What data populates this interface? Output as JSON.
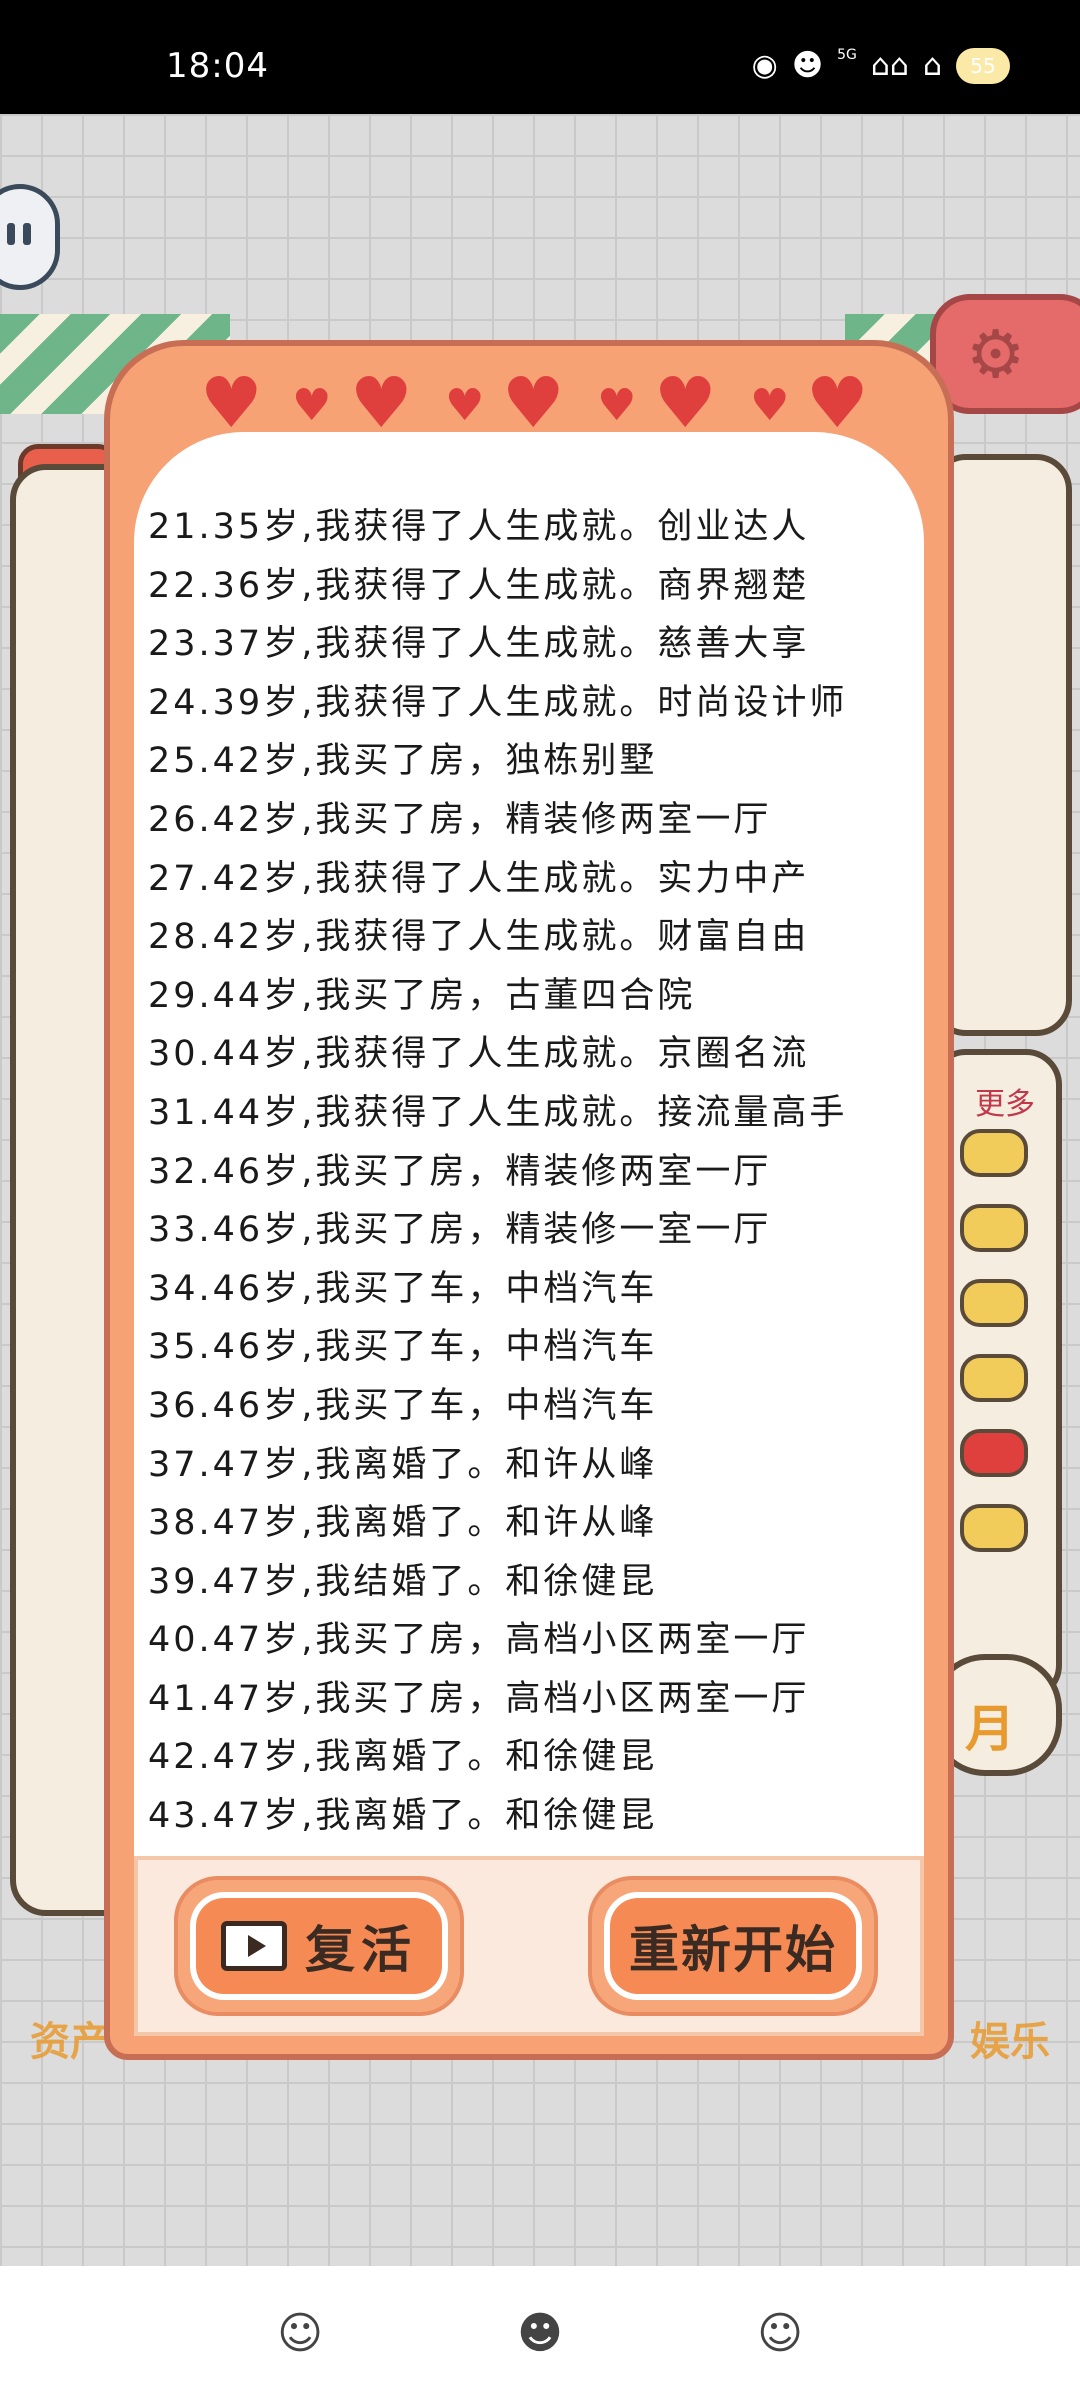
{
  "status_bar": {
    "time": "18:04",
    "network": "5G",
    "icons": [
      "eye-icon",
      "pet-icon",
      "signal-icon",
      "signal-icon",
      "wifi-icon"
    ],
    "battery_label": "55"
  },
  "background": {
    "more_label": "更多",
    "month_label": "月",
    "bottom_tabs": [
      "资产",
      "",
      "",
      "娱乐"
    ]
  },
  "modal": {
    "log": [
      "21.35岁,我获得了人生成就。创业达人",
      "22.36岁,我获得了人生成就。商界翘楚",
      "23.37岁,我获得了人生成就。慈善大享",
      "24.39岁,我获得了人生成就。时尚设计师",
      "25.42岁,我买了房，独栋别墅",
      "26.42岁,我买了房，精装修两室一厅",
      "27.42岁,我获得了人生成就。实力中产",
      "28.42岁,我获得了人生成就。财富自由",
      "29.44岁,我买了房，古董四合院",
      "30.44岁,我获得了人生成就。京圈名流",
      "31.44岁,我获得了人生成就。接流量高手",
      "32.46岁,我买了房，精装修两室一厅",
      "33.46岁,我买了房，精装修一室一厅",
      "34.46岁,我买了车，中档汽车",
      "35.46岁,我买了车，中档汽车",
      "36.46岁,我买了车，中档汽车",
      "37.47岁,我离婚了。和许从峰",
      "38.47岁,我离婚了。和许从峰",
      "39.47岁,我结婚了。和徐健昆",
      "40.47岁,我买了房，高档小区两室一厅",
      "41.47岁,我买了房，高档小区两室一厅",
      "42.47岁,我离婚了。和徐健昆",
      "43.47岁,我离婚了。和徐健昆"
    ],
    "revive_label": "复活",
    "restart_label": "重新开始"
  },
  "colors": {
    "modal_bg": "#f6a274",
    "heart": "#e0403d",
    "button_face": "#f58a55",
    "text": "#1a1a1a"
  }
}
